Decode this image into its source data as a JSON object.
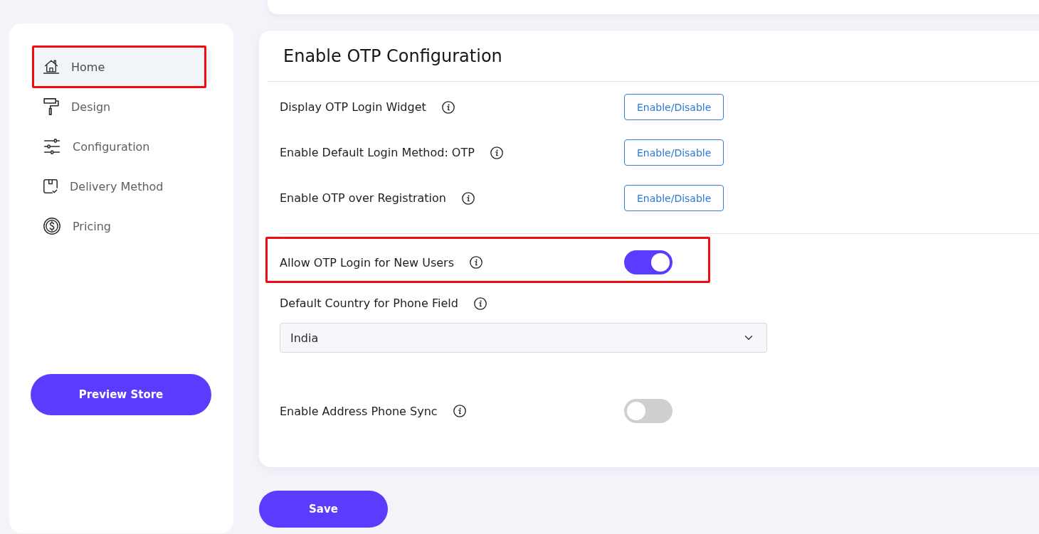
{
  "sidebar": {
    "items": [
      {
        "label": "Home",
        "selected": true,
        "highlighted": true
      },
      {
        "label": "Design",
        "selected": false,
        "highlighted": false
      },
      {
        "label": "Configuration",
        "selected": false,
        "highlighted": false
      },
      {
        "label": "Delivery Method",
        "selected": false,
        "highlighted": false
      },
      {
        "label": "Pricing",
        "selected": false,
        "highlighted": false
      }
    ],
    "button": "Preview Store"
  },
  "panel": {
    "title": "Enable OTP Configuration",
    "sections": [
      {
        "settings": [
          {
            "kind": "button",
            "label": "Display OTP Login Widget",
            "button": "Enable/Disable",
            "highlighted": false
          },
          {
            "kind": "button",
            "label": "Enable Default Login Method: OTP",
            "button": "Enable/Disable",
            "highlighted": false
          },
          {
            "kind": "button",
            "label": "Enable OTP over Registration",
            "button": "Enable/Disable",
            "highlighted": false
          }
        ]
      },
      {
        "settings": [
          {
            "kind": "toggle",
            "label": "Allow OTP Login for New Users",
            "on": true,
            "highlighted": true
          },
          {
            "kind": "select",
            "label": "Default Country for Phone Field",
            "value": "India",
            "highlighted": false
          },
          {
            "kind": "toggle",
            "label": "Enable Address Phone Sync",
            "on": false,
            "highlighted": false
          }
        ]
      }
    ]
  },
  "save_button": "Save"
}
